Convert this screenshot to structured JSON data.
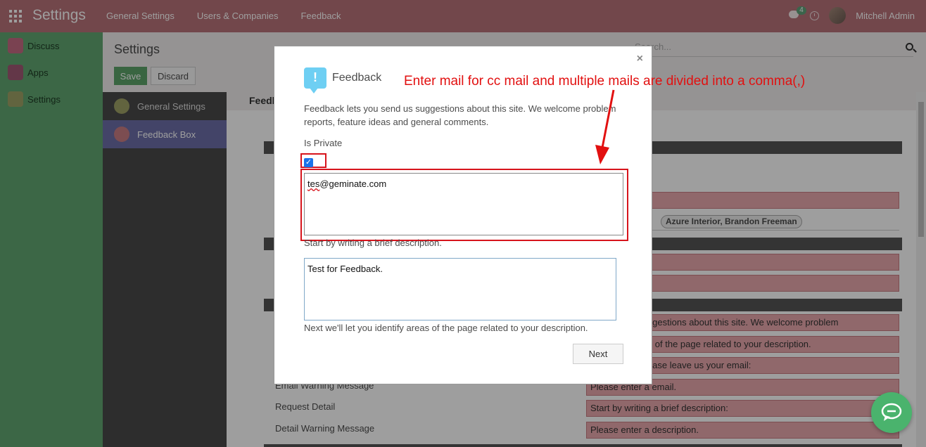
{
  "navbar": {
    "brand": "Settings",
    "menu": [
      "General Settings",
      "Users & Companies",
      "Feedback"
    ],
    "chat_badge": "4",
    "user_name": "Mitchell Admin"
  },
  "app_sidebar": {
    "items": [
      {
        "label": "Discuss",
        "icon": "discuss-icon"
      },
      {
        "label": "Apps",
        "icon": "apps-icon"
      },
      {
        "label": "Settings",
        "icon": "settings-icon"
      }
    ]
  },
  "control_panel": {
    "title": "Settings",
    "save_label": "Save",
    "discard_label": "Discard",
    "search_placeholder": "Search..."
  },
  "settings_menu": {
    "items": [
      {
        "label": "General Settings",
        "active": false
      },
      {
        "label": "Feedback Box",
        "active": true
      }
    ]
  },
  "background": {
    "header": "Feedb",
    "tags": [
      "Azure Interior, Brandon Freeman"
    ],
    "fields": [
      "ou send us suggestions about this site. We welcome problem",
      "u identify areas of the page related to your description.",
      "e contacted please leave us your email:",
      "Please enter a email.",
      "Start by writing a brief description:",
      "Please enter a description."
    ],
    "labels": [
      "Email Warning Message",
      "Request Detail",
      "Detail Warning Message"
    ]
  },
  "modal": {
    "title": "Feedback",
    "intro": "Feedback lets you send us suggestions about this site. We welcome problem reports, feature ideas and general comments.",
    "private_label": "Is Private",
    "private_checked": true,
    "cc_prefix": "tes",
    "cc_suffix": "@geminate.com",
    "desc_hint": "Start by writing a brief description.",
    "desc_value": "Test for Feedback.",
    "next_hint": "Next we'll let you identify areas of the page related to your description.",
    "next_label": "Next"
  },
  "annotation": {
    "text": "Enter mail for cc mail and multiple mails are divided into a comma(,)",
    "color": "#e21010"
  },
  "colors": {
    "navbar": "#b97379",
    "sidebar": "#61a771",
    "active_menu": "#6c6fa8",
    "highlight": "#d7141c"
  }
}
